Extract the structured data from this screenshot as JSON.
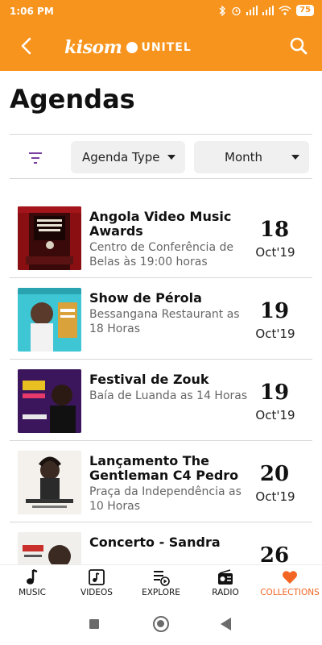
{
  "status": {
    "time": "1:06 PM",
    "battery": "75"
  },
  "app": {
    "logo_main": "kisom",
    "logo_partner": "UNITEL"
  },
  "page": {
    "title": "Agendas"
  },
  "filters": {
    "agenda_type_label": "Agenda Type",
    "month_label": "Month"
  },
  "events": [
    {
      "title": "Angola Video Music Awards",
      "subtitle": "Centro de Conferência de Belas às 19:00 horas",
      "day": "18",
      "month": "Oct'19"
    },
    {
      "title": "Show de Pérola",
      "subtitle": "Bessangana Restaurant as 18 Horas",
      "day": "19",
      "month": "Oct'19"
    },
    {
      "title": "Festival de Zouk",
      "subtitle": "Baía de Luanda as 14 Horas",
      "day": "19",
      "month": "Oct'19"
    },
    {
      "title": "Lançamento The Gentleman C4 Pedro",
      "subtitle": "Praça da Independência as 10 Horas",
      "day": "20",
      "month": "Oct'19"
    },
    {
      "title": "Concerto - Sandra",
      "subtitle": "",
      "day": "26",
      "month": ""
    }
  ],
  "nav": {
    "music": "MUSIC",
    "videos": "VIDEOS",
    "explore": "EXPLORE",
    "radio": "RADIO",
    "collections": "COLLECTIONS"
  },
  "colors": {
    "accent": "#f7941d",
    "active_nav": "#f26522",
    "filter_icon": "#7b3fa0"
  }
}
